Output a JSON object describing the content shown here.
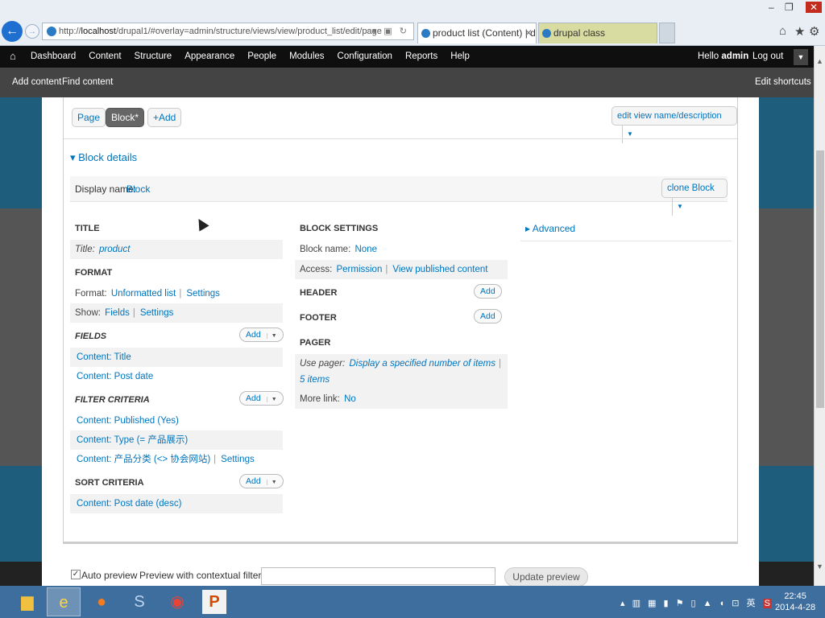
{
  "browser": {
    "url_prefix": "http://",
    "url_host": "localhost",
    "url_path": "/drupal1/#overlay=admin/structure/views/view/product_list/edit/page",
    "tabs": [
      {
        "label": "product list (Content) | dr...",
        "active": true
      },
      {
        "label": "drupal class",
        "active": false
      }
    ],
    "window_controls": [
      "–",
      "❐",
      "✕"
    ]
  },
  "toolbar": {
    "menu": [
      "Dashboard",
      "Content",
      "Structure",
      "Appearance",
      "People",
      "Modules",
      "Configuration",
      "Reports",
      "Help"
    ],
    "hello_prefix": "Hello ",
    "user": "admin",
    "logout": "Log out"
  },
  "shortcuts": {
    "items": [
      "Add content",
      "Find content"
    ],
    "edit": "Edit shortcuts"
  },
  "display_tabs": {
    "page": "Page",
    "block": "Block*",
    "add": "+Add",
    "edit_name": "edit view name/description"
  },
  "details": {
    "toggle": "▾ Block details",
    "display_name_label": "Display name:",
    "display_name_value": "Block",
    "clone": "clone Block"
  },
  "left": {
    "title_head": "TITLE",
    "title_label": "Title:",
    "title_value": "product",
    "format_head": "FORMAT",
    "format_label": "Format:",
    "format_value": "Unformatted list",
    "format_settings": "Settings",
    "show_label": "Show:",
    "show_value": "Fields",
    "show_settings": "Settings",
    "fields_head": "FIELDS",
    "fields": [
      "Content: Title",
      "Content: Post date"
    ],
    "filter_head": "FILTER CRITERIA",
    "filters": [
      "Content: Published (Yes)",
      "Content: Type (= 产品展示)",
      "Content: 产品分类 (<> 协会网站)"
    ],
    "filter_settings": "Settings",
    "sort_head": "SORT CRITERIA",
    "sorts": [
      "Content: Post date (desc)"
    ],
    "add": "Add"
  },
  "middle": {
    "block_settings_head": "BLOCK SETTINGS",
    "block_name_label": "Block name:",
    "block_name_value": "None",
    "access_label": "Access:",
    "access_value": "Permission",
    "access_value2": "View published content",
    "header_head": "HEADER",
    "footer_head": "FOOTER",
    "pager_head": "PAGER",
    "use_pager_label": "Use pager:",
    "use_pager_value": "Display a specified number of items",
    "pager_items": "5 items",
    "more_link_label": "More link:",
    "more_link_value": "No",
    "add": "Add"
  },
  "right": {
    "advanced": "▸ Advanced"
  },
  "preview": {
    "auto_preview": "Auto preview",
    "contextual_label": "Preview with contextual filters:",
    "contextual_value": "",
    "update": "Update preview"
  },
  "taskbar": {
    "time": "22:45",
    "date": "2014-4-28",
    "tray_ime": "英"
  }
}
